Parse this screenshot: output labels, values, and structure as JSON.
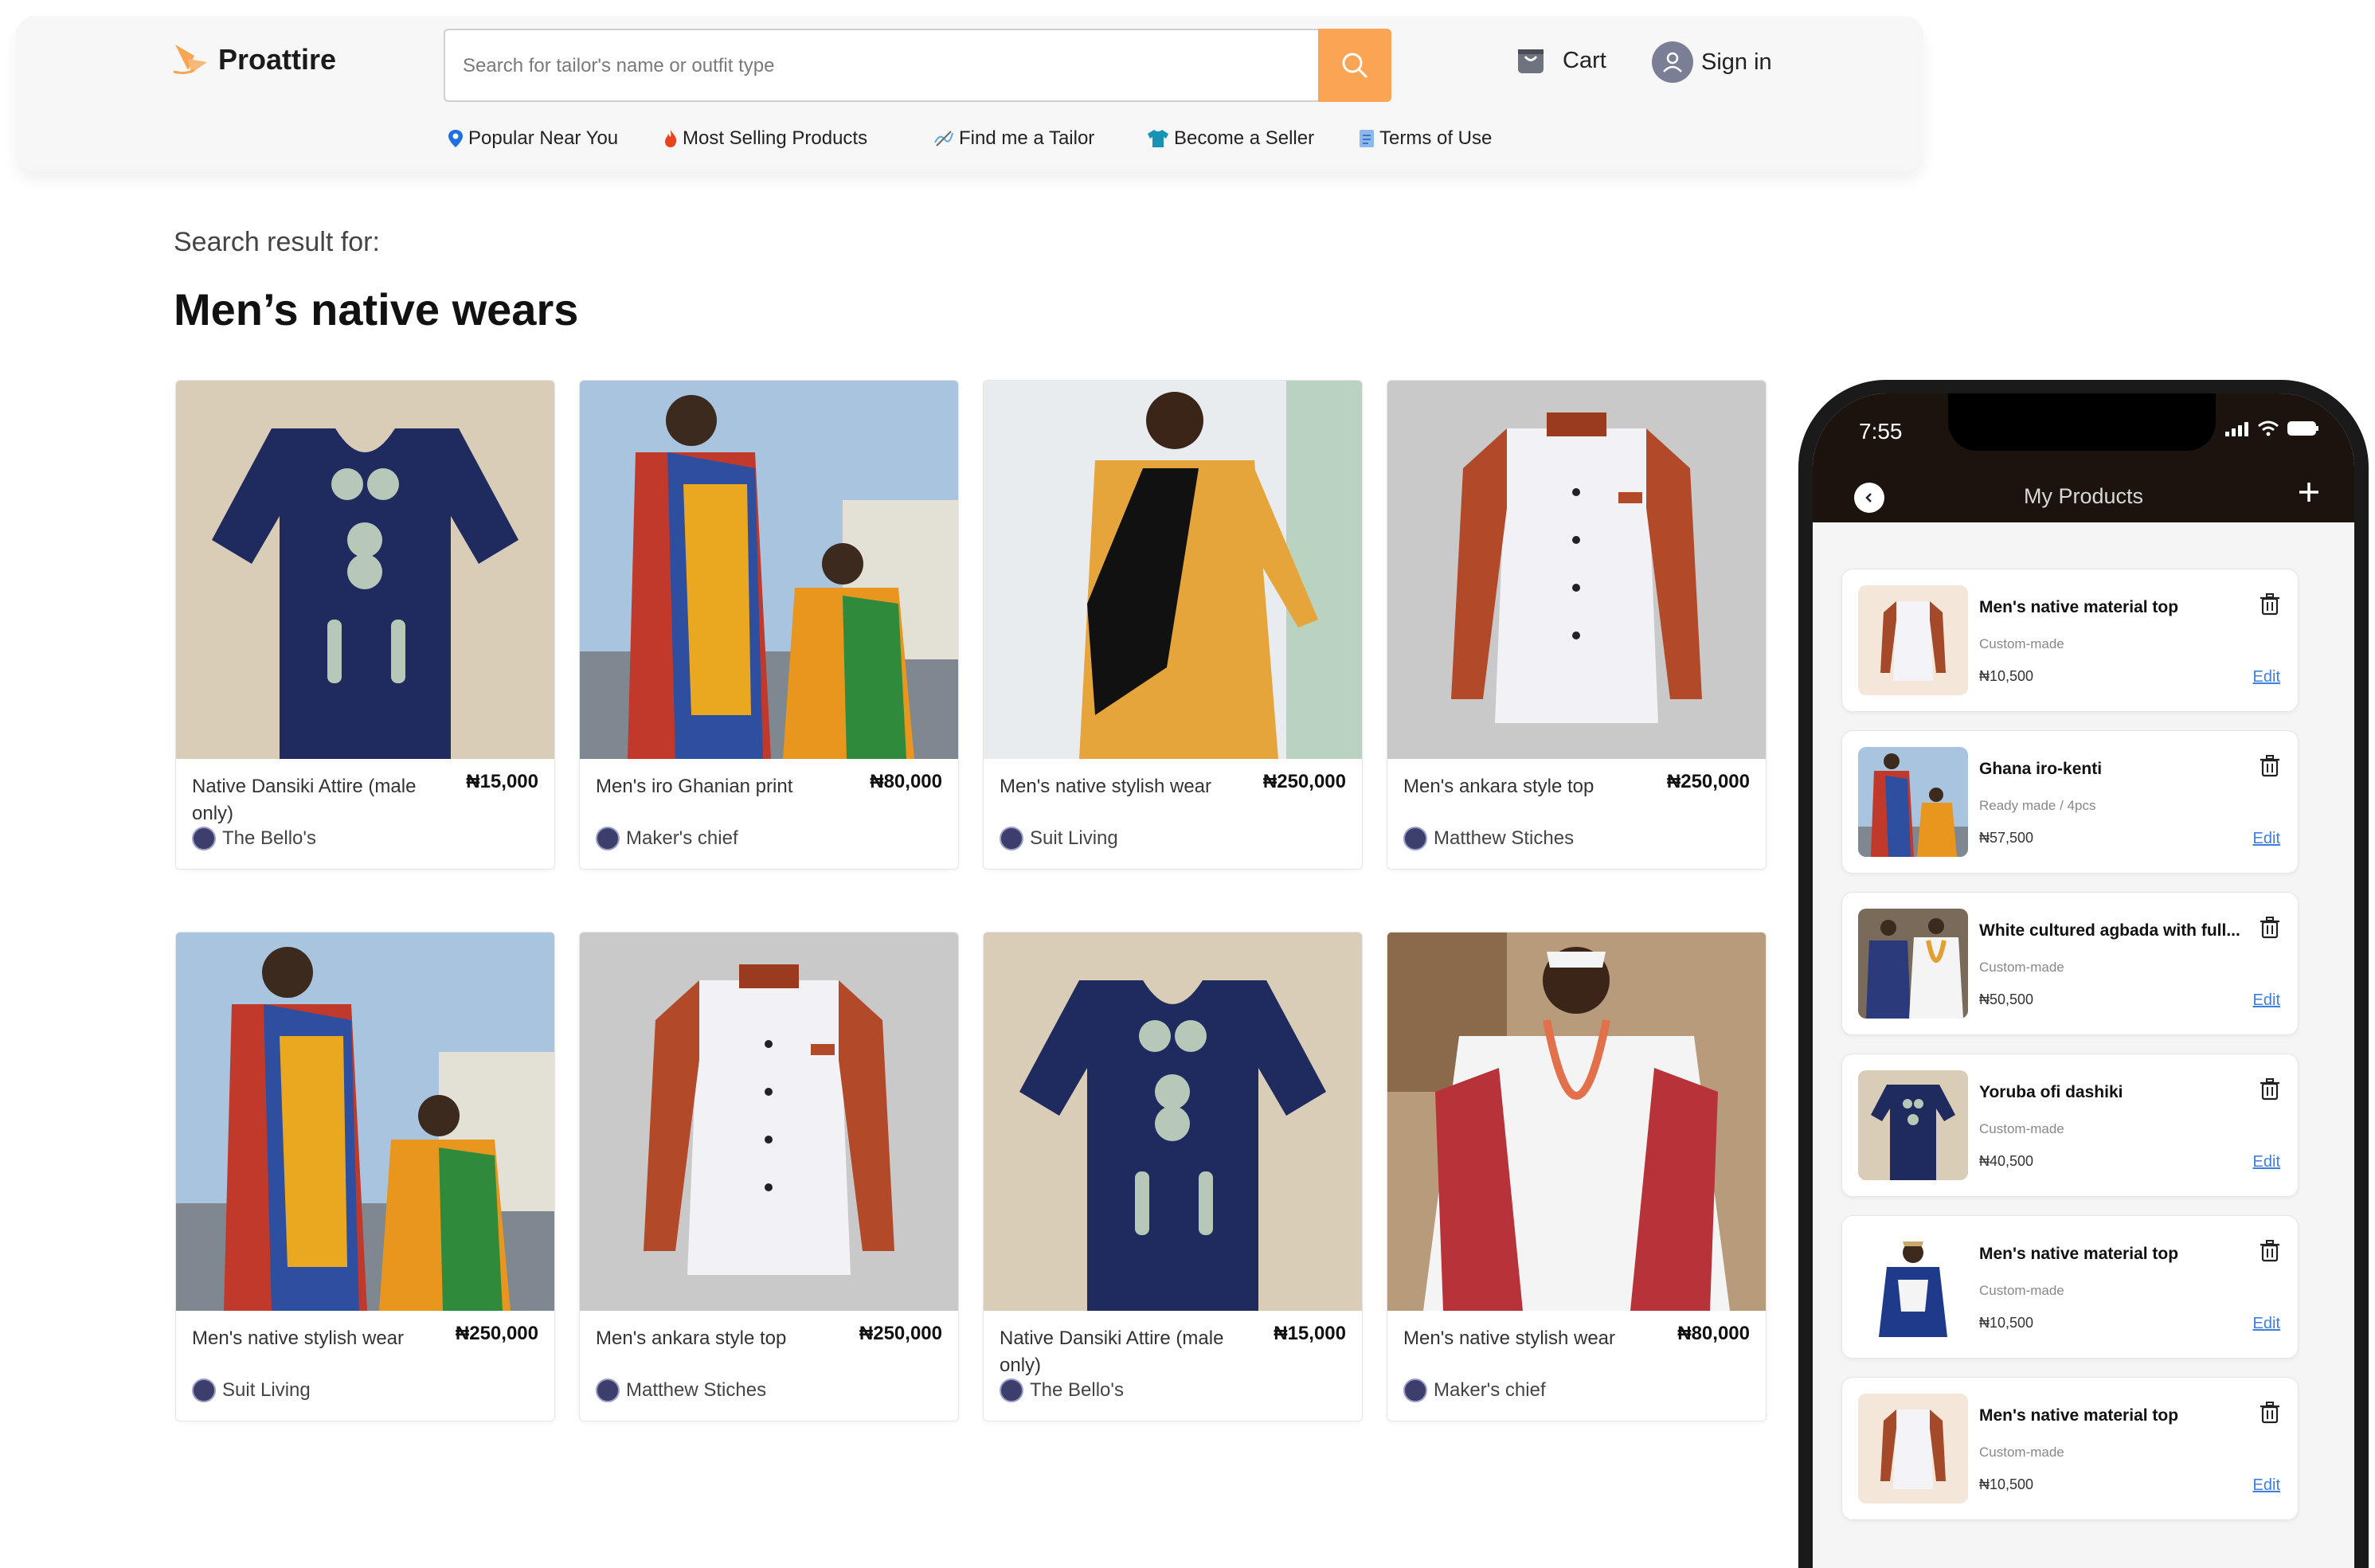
{
  "brand": {
    "name": "Proattire",
    "accent": "#f9a553"
  },
  "search": {
    "placeholder": "Search for tailor's name or outfit type"
  },
  "header": {
    "cart_label": "Cart",
    "signin_label": "Sign in"
  },
  "nav": [
    {
      "label": "Popular Near You",
      "icon": "location-pin-icon"
    },
    {
      "label": "Most Selling Products",
      "icon": "fire-icon"
    },
    {
      "label": "Find me a Tailor",
      "icon": "needle-thread-icon"
    },
    {
      "label": "Become a Seller",
      "icon": "shirt-icon"
    },
    {
      "label": "Terms of Use",
      "icon": "document-icon"
    }
  ],
  "results": {
    "label": "Search result for:",
    "query": "Men’s native wears"
  },
  "products": [
    {
      "name": "Native Dansiki Attire (male only)",
      "price": "₦15,000",
      "seller": "The Bello's"
    },
    {
      "name": "Men's iro Ghanian print",
      "price": "₦80,000",
      "seller": "Maker's chief"
    },
    {
      "name": "Men's native stylish wear",
      "price": "₦250,000",
      "seller": "Suit Living"
    },
    {
      "name": "Men's ankara style top",
      "price": "₦250,000",
      "seller": "Matthew Stiches"
    },
    {
      "name": "Men's native stylish wear",
      "price": "₦250,000",
      "seller": "Suit Living"
    },
    {
      "name": "Men's ankara style top",
      "price": "₦250,000",
      "seller": "Matthew Stiches"
    },
    {
      "name": "Native Dansiki Attire (male only)",
      "price": "₦15,000",
      "seller": "The Bello's"
    },
    {
      "name": "Men's native stylish wear",
      "price": "₦80,000",
      "seller": "Maker's chief"
    }
  ],
  "phone": {
    "time": "7:55",
    "title": "My Products",
    "edit_label": "Edit",
    "items": [
      {
        "name": "Men's native material top",
        "type": "Custom-made",
        "price": "₦10,500"
      },
      {
        "name": "Ghana iro-kenti",
        "type": "Ready made / 4pcs",
        "price": "₦57,500"
      },
      {
        "name": "White cultured agbada with full...",
        "type": "Custom-made",
        "price": "₦50,500"
      },
      {
        "name": "Yoruba ofi dashiki",
        "type": "Custom-made",
        "price": "₦40,500"
      },
      {
        "name": "Men's native material top",
        "type": "Custom-made",
        "price": "₦10,500"
      },
      {
        "name": "Men's native material top",
        "type": "Custom-made",
        "price": "₦10,500"
      }
    ]
  }
}
